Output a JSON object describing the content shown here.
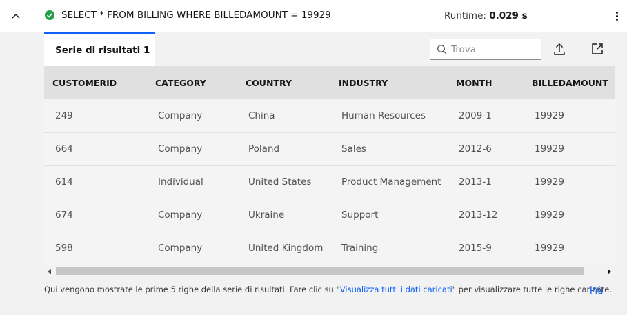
{
  "header": {
    "query": "SELECT * FROM BILLING WHERE BILLEDAMOUNT = 19929",
    "runtime_label": "Runtime:",
    "runtime_value": "0.029 s",
    "status_color": "#24a148"
  },
  "tabs": [
    {
      "label": "Serie di risultati 1"
    }
  ],
  "toolbar": {
    "search_placeholder": "Trova",
    "export_icon": "upload-icon",
    "popout_icon": "launch-icon"
  },
  "table": {
    "columns": [
      "CUSTOMERID",
      "CATEGORY",
      "COUNTRY",
      "INDUSTRY",
      "MONTH",
      "BILLEDAMOUNT"
    ],
    "rows": [
      [
        "249",
        "Company",
        "China",
        "Human Resources",
        "2009-1",
        "19929"
      ],
      [
        "664",
        "Company",
        "Poland",
        "Sales",
        "2012-6",
        "19929"
      ],
      [
        "614",
        "Individual",
        "United States",
        "Product Management",
        "2013-1",
        "19929"
      ],
      [
        "674",
        "Company",
        "Ukraine",
        "Support",
        "2013-12",
        "19929"
      ],
      [
        "598",
        "Company",
        "United Kingdom",
        "Training",
        "2015-9",
        "19929"
      ]
    ]
  },
  "footer": {
    "note_before": "Qui vengono mostrate le prime 5 righe della serie di risultati. Fare clic su \"",
    "note_link": "Visualizza tutti i dati caricati",
    "note_after": "\" per visualizzare tutte le righe caricate.",
    "more_label": "Più"
  },
  "colors": {
    "accent": "#0f62fe",
    "success": "#24a148"
  }
}
